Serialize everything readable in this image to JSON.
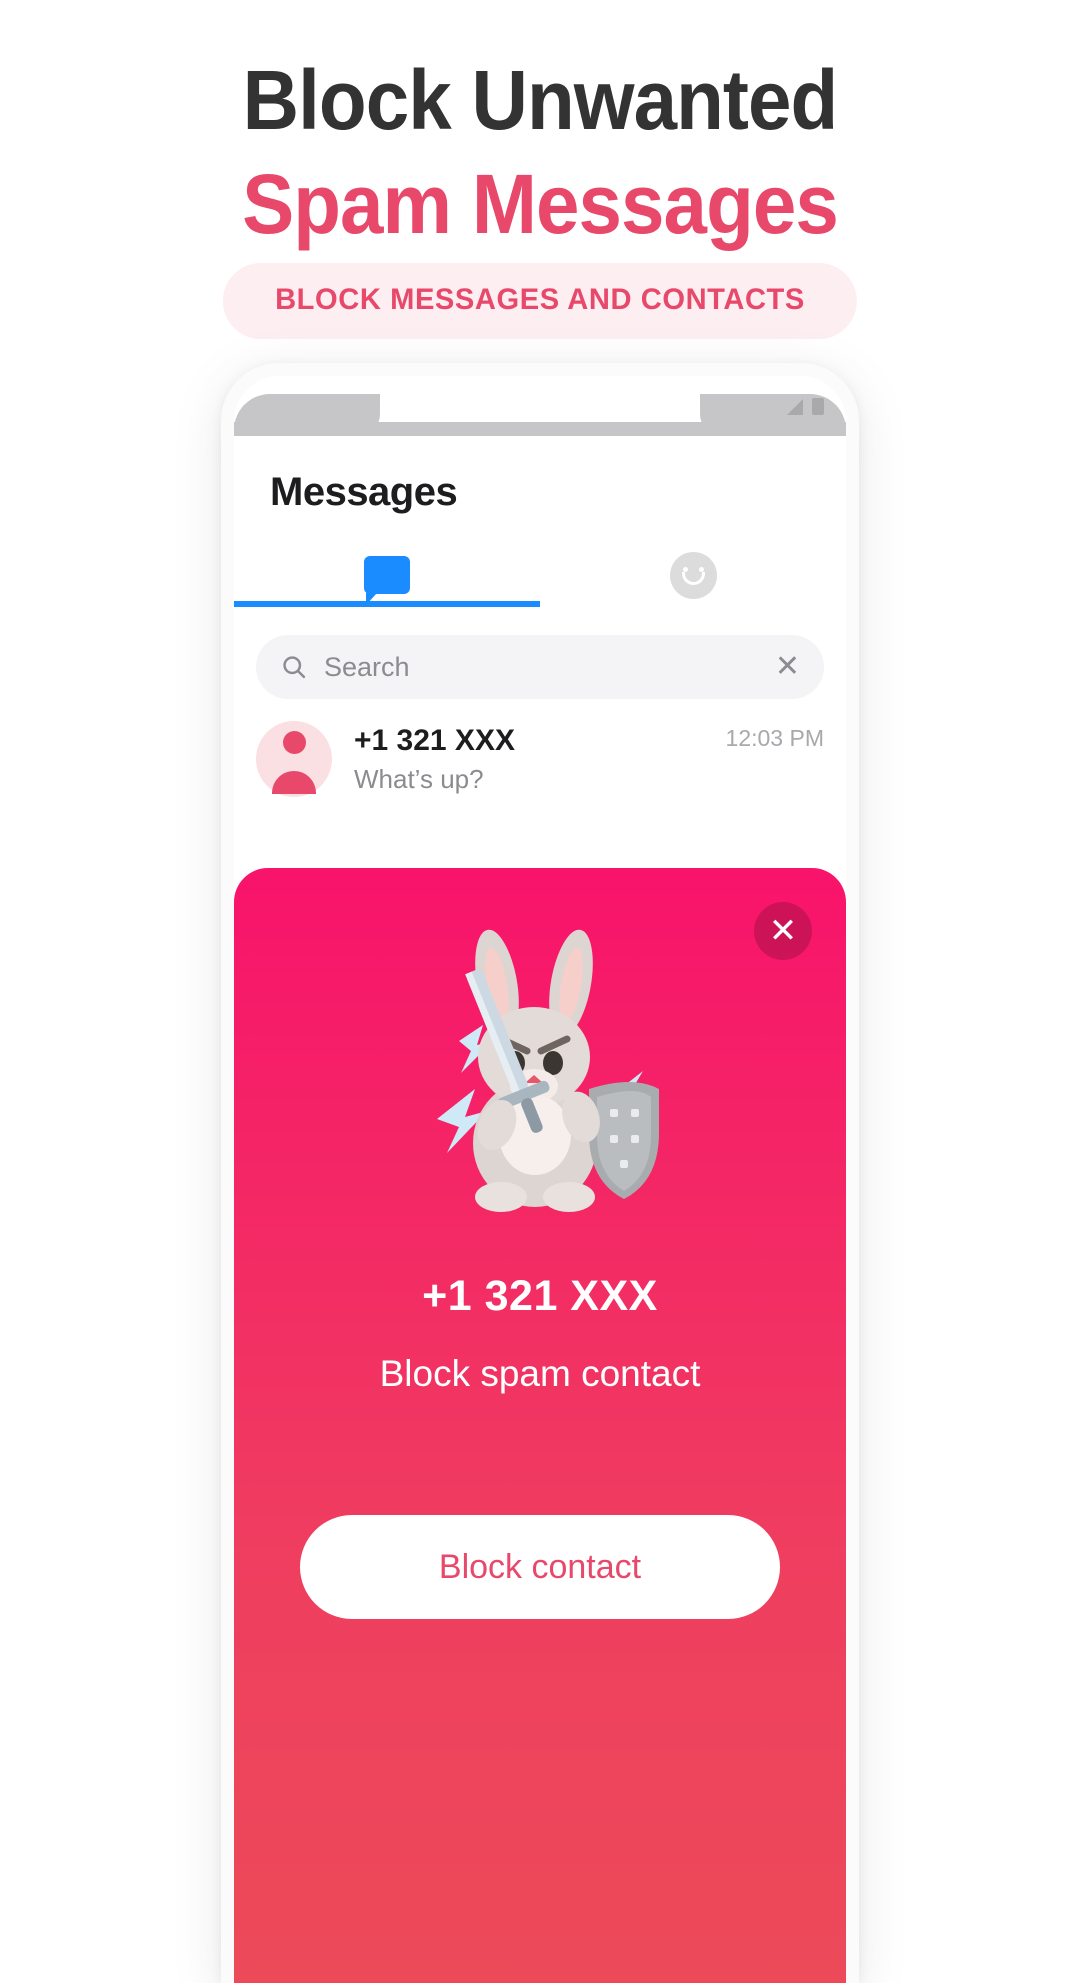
{
  "promo": {
    "headline_line1": "Block Unwanted",
    "headline_line2": "Spam Messages",
    "badge": "BLOCK MESSAGES AND CONTACTS",
    "colors": {
      "accent_pink": "#e8496b",
      "headline_dark": "#333333",
      "badge_bg": "#fceef1",
      "tab_blue": "#1a8cff",
      "card_gradient_top": "#f8136b",
      "card_gradient_bottom": "#ec4a59"
    }
  },
  "phone": {
    "status_bar": {
      "signal_icon": "signal-triangle-icon",
      "battery_icon": "battery-icon"
    },
    "app": {
      "title": "Messages",
      "tabs": [
        {
          "id": "chat",
          "icon": "chat-bubble-icon",
          "active": true
        },
        {
          "id": "emoji",
          "icon": "smiley-face-icon",
          "active": false
        }
      ],
      "search": {
        "placeholder": "Search",
        "value": "",
        "search_icon": "search-icon",
        "clear_icon": "close-x-icon",
        "clear_glyph": "✕"
      },
      "conversations": [
        {
          "avatar_icon": "person-avatar-icon",
          "name": "+1 321 XXX",
          "snippet": "What’s up?",
          "time": "12:03 PM"
        }
      ]
    },
    "block_card": {
      "close_icon": "close-x-icon",
      "close_glyph": "✕",
      "mascot_icon": "bunny-knight-mascot-icon",
      "phone_number": "+1 321 XXX",
      "subtitle": "Block spam contact",
      "button_label": "Block contact"
    }
  }
}
